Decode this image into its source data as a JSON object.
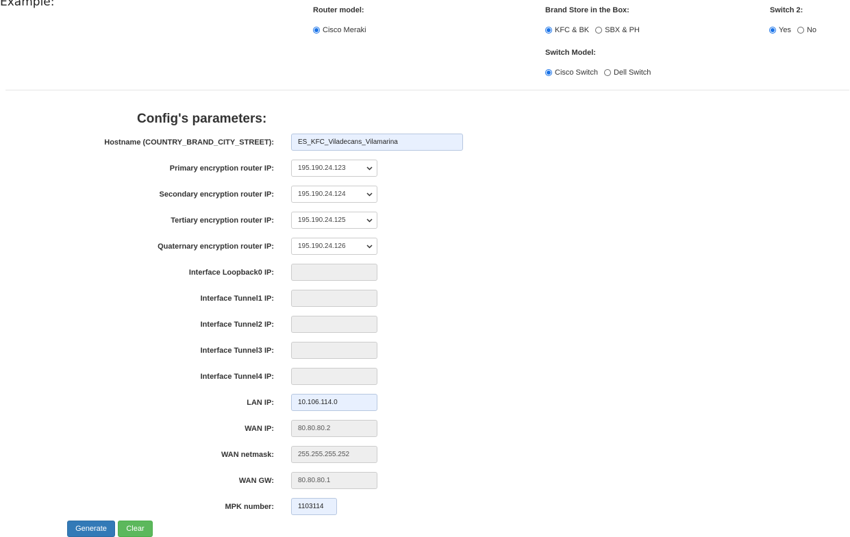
{
  "page": {
    "corner_text": "Example:"
  },
  "options": {
    "router_model": {
      "label": "Router model:",
      "choices": [
        {
          "text": "Cisco Meraki",
          "checked": true
        }
      ]
    },
    "brand_store": {
      "label": "Brand Store in the Box:",
      "choices": [
        {
          "text": "KFC & BK",
          "checked": true
        },
        {
          "text": "SBX & PH",
          "checked": false
        }
      ]
    },
    "switch2": {
      "label": "Switch 2:",
      "choices": [
        {
          "text": "Yes",
          "checked": true
        },
        {
          "text": "No",
          "checked": false
        }
      ]
    },
    "switch_model": {
      "label": "Switch Model:",
      "choices": [
        {
          "text": "Cisco Switch",
          "checked": true
        },
        {
          "text": "Dell Switch",
          "checked": false
        }
      ]
    }
  },
  "config": {
    "title": "Config's parameters:",
    "fields": {
      "hostname": {
        "label": "Hostname (COUNTRY_BRAND_CITY_STREET):",
        "value": "ES_KFC_Viladecans_Vilamarina"
      },
      "primary_ip": {
        "label": "Primary encryption router IP:",
        "value": "195.190.24.123"
      },
      "secondary_ip": {
        "label": "Secondary encryption router IP:",
        "value": "195.190.24.124"
      },
      "tertiary_ip": {
        "label": "Tertiary encryption router IP:",
        "value": "195.190.24.125"
      },
      "quaternary_ip": {
        "label": "Quaternary encryption router IP:",
        "value": "195.190.24.126"
      },
      "loopback0": {
        "label": "Interface Loopback0 IP:",
        "value": ""
      },
      "tunnel1": {
        "label": "Interface Tunnel1 IP:",
        "value": ""
      },
      "tunnel2": {
        "label": "Interface Tunnel2 IP:",
        "value": ""
      },
      "tunnel3": {
        "label": "Interface Tunnel3 IP:",
        "value": ""
      },
      "tunnel4": {
        "label": "Interface Tunnel4 IP:",
        "value": ""
      },
      "lan_ip": {
        "label": "LAN IP:",
        "value": "10.106.114.0"
      },
      "wan_ip": {
        "label": "WAN IP:",
        "value": "80.80.80.2"
      },
      "wan_netmask": {
        "label": "WAN netmask:",
        "value": "255.255.255.252"
      },
      "wan_gw": {
        "label": "WAN GW:",
        "value": "80.80.80.1"
      },
      "mpk": {
        "label": "MPK number:",
        "value": "1103114"
      }
    }
  },
  "actions": {
    "generate": "Generate",
    "clear": "Clear"
  },
  "colors": {
    "accent": "#1a73e8",
    "generate_bg": "#337ab7",
    "clear_bg": "#5cb85c",
    "readonly_bg": "#eeeeee",
    "edit_bg": "#e8f0fe"
  },
  "icons": {
    "select": "chevron-down-icon"
  }
}
